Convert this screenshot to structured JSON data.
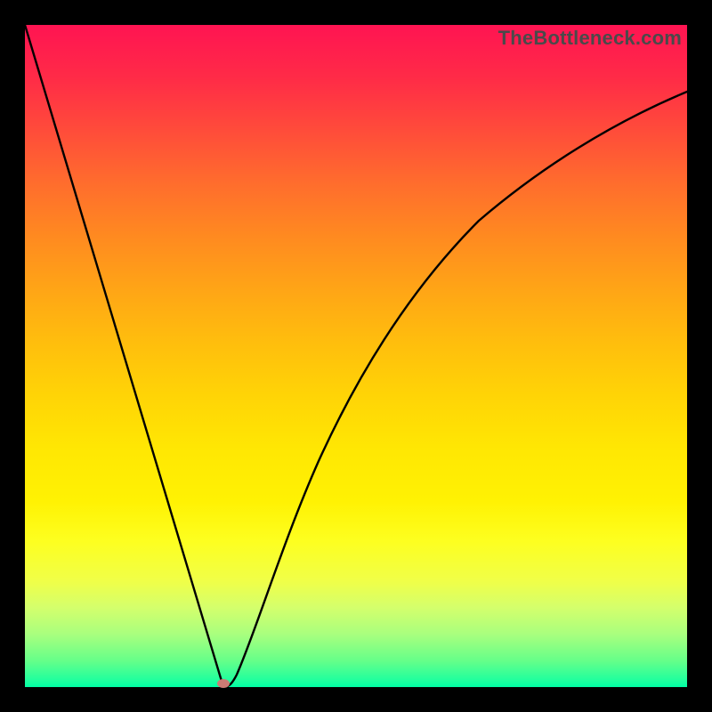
{
  "watermark": "TheBottleneck.com",
  "chart_data": {
    "type": "line",
    "title": "",
    "xlabel": "",
    "ylabel": "",
    "xlim": [
      0,
      1
    ],
    "ylim": [
      0,
      1
    ],
    "series": [
      {
        "name": "bottleneck-curve",
        "x": [
          0.0,
          0.05,
          0.1,
          0.15,
          0.2,
          0.24,
          0.27,
          0.29,
          0.3,
          0.31,
          0.33,
          0.36,
          0.4,
          0.45,
          0.5,
          0.55,
          0.6,
          0.65,
          0.7,
          0.75,
          0.8,
          0.85,
          0.9,
          0.95,
          1.0
        ],
        "values": [
          1.0,
          0.83,
          0.66,
          0.5,
          0.33,
          0.2,
          0.1,
          0.03,
          0.0,
          0.02,
          0.08,
          0.18,
          0.3,
          0.42,
          0.52,
          0.6,
          0.67,
          0.72,
          0.77,
          0.8,
          0.83,
          0.85,
          0.87,
          0.89,
          0.9
        ]
      }
    ],
    "marker": {
      "x": 0.3,
      "y": 0.0,
      "color": "#cd7b74"
    },
    "gradient_stops": [
      {
        "pos": 0.0,
        "color": "#ff1452"
      },
      {
        "pos": 0.5,
        "color": "#ffd000"
      },
      {
        "pos": 0.8,
        "color": "#fdff20"
      },
      {
        "pos": 1.0,
        "color": "#00ffa4"
      }
    ]
  }
}
